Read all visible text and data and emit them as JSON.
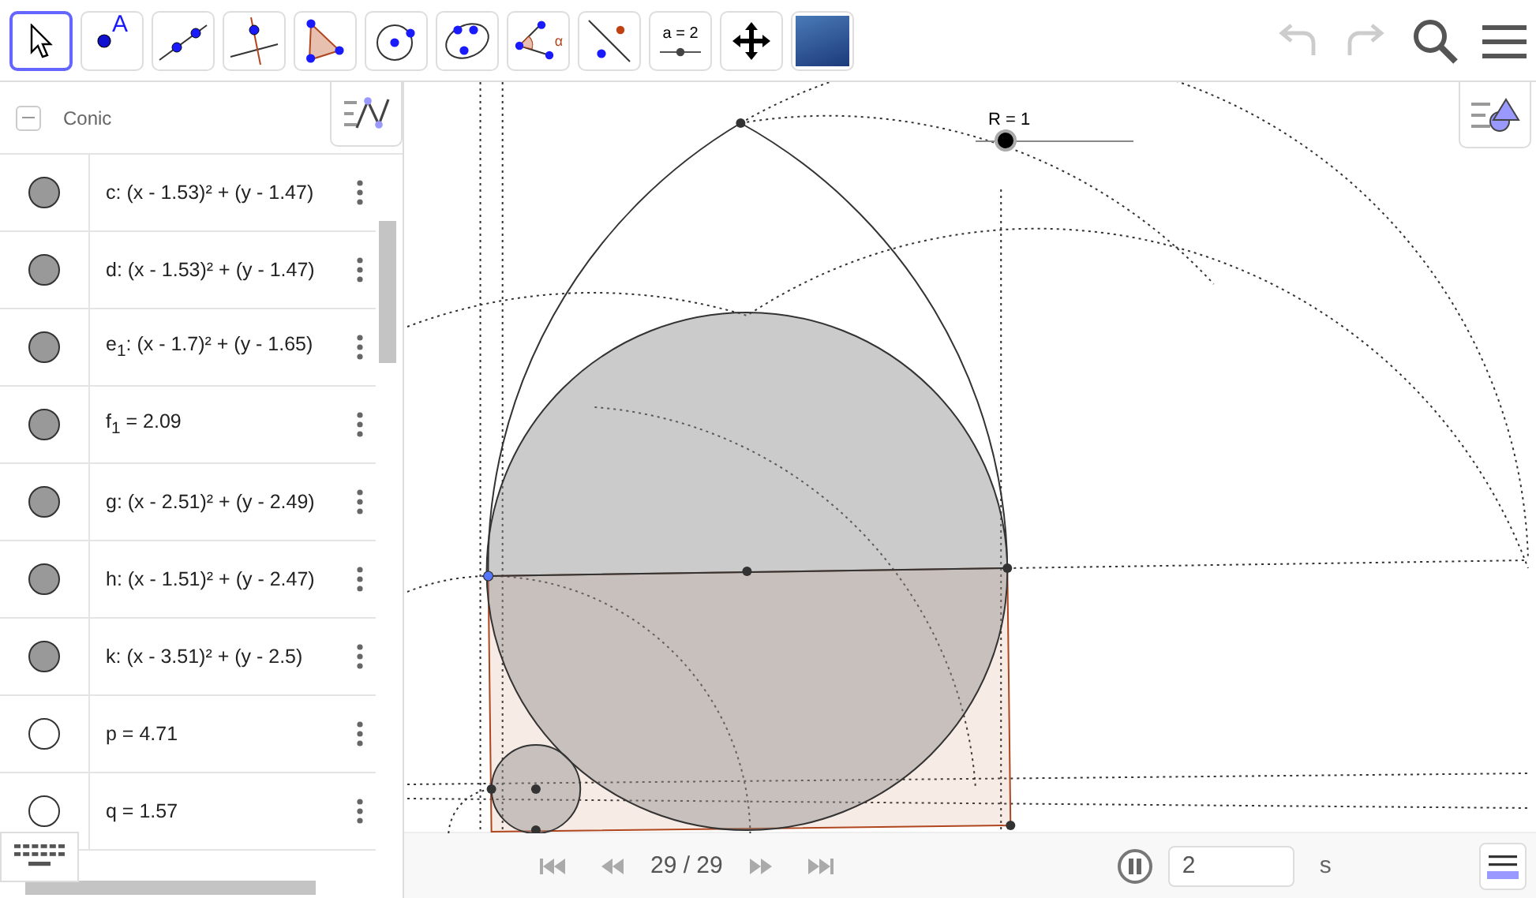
{
  "toolbar": {
    "tools": [
      {
        "kind": "move",
        "selected": true
      },
      {
        "kind": "point",
        "label": "A",
        "selected": false
      },
      {
        "kind": "line",
        "selected": false
      },
      {
        "kind": "perpendicular",
        "selected": false
      },
      {
        "kind": "polygon",
        "selected": false
      },
      {
        "kind": "circle",
        "selected": false
      },
      {
        "kind": "conic",
        "selected": false
      },
      {
        "kind": "angle",
        "label": "α",
        "selected": false
      },
      {
        "kind": "reflect",
        "selected": false
      },
      {
        "kind": "slider",
        "label": "a = 2",
        "selected": false
      },
      {
        "kind": "pan",
        "selected": false
      },
      {
        "kind": "image",
        "selected": false
      }
    ]
  },
  "algebra": {
    "group": "Conic",
    "rows": [
      {
        "text": "c: (x - 1.53)² + (y - 1.47)",
        "visible": true
      },
      {
        "text": "d: (x - 1.53)² + (y - 1.47)",
        "visible": true
      },
      {
        "text": "e$_{1}$: (x - 1.7)² + (y - 1.65)",
        "visible": true
      },
      {
        "text": "f$_{1}$ = 2.09",
        "visible": true
      },
      {
        "text": "g: (x - 2.51)² + (y - 2.49)",
        "visible": true
      },
      {
        "text": "h: (x - 1.51)² + (y - 2.47)",
        "visible": true
      },
      {
        "text": "k: (x - 3.51)² + (y - 2.5)",
        "visible": true
      },
      {
        "text": "p = 4.71",
        "visible": false
      },
      {
        "text": "q = 1.57",
        "visible": false
      }
    ]
  },
  "graphics": {
    "slider": {
      "label": "R = 1",
      "level": 0.19
    }
  },
  "animation": {
    "step": "29 / 29",
    "playing": true,
    "speed": "2",
    "unit": "s"
  }
}
